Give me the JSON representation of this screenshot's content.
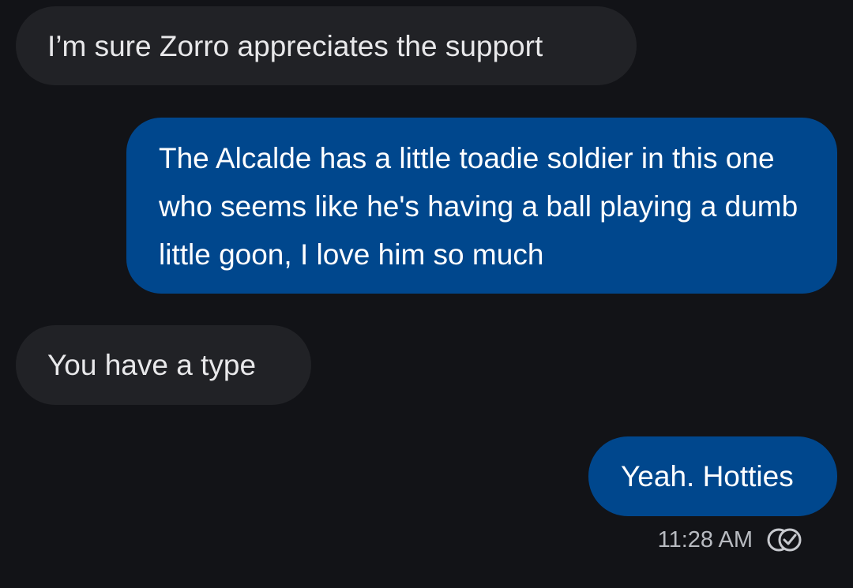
{
  "messages": [
    {
      "direction": "incoming",
      "text": "I’m sure Zorro appreciates the support"
    },
    {
      "direction": "outgoing",
      "text": "The Alcalde has a little toadie soldier in this one who seems like he's having a ball playing a dumb little goon, I love him so much"
    },
    {
      "direction": "incoming",
      "text": "You have a type"
    },
    {
      "direction": "outgoing",
      "text": "Yeah. Hotties"
    }
  ],
  "last_message_time": "11:28 AM",
  "delivery_status_icon": "read-check-icon",
  "colors": {
    "background": "#121317",
    "incoming_bubble": "#212226",
    "outgoing_bubble": "#00478d",
    "text": "#ffffff",
    "timestamp": "#b8bbc1"
  }
}
